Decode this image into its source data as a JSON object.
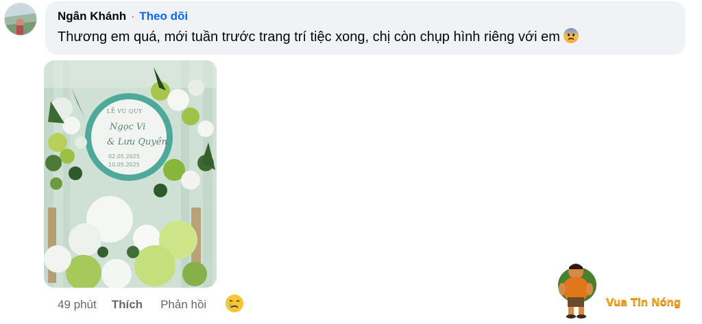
{
  "comment": {
    "author": "Ngân Khánh",
    "separator": "·",
    "follow_label": "Theo dõi",
    "text": "Thương em quá, mới tuần trước trang trí tiệc xong, chị còn chụp hình riêng với em",
    "text_emoji": "anxious-face-with-sweat-icon"
  },
  "photo": {
    "sign_title": "LỄ VU QUY",
    "name_line_1": "Ngọc Vi",
    "name_line_2": "& Lưu Quyền",
    "date_1": "02.05.2025",
    "date_2": "10.05.2025"
  },
  "actions": {
    "time": "49 phút",
    "like_label": "Thích",
    "reply_label": "Phản hồi",
    "reaction_icon": "crying-face-icon"
  },
  "watermark": {
    "brand": "Vua Tin Nóng"
  },
  "colors": {
    "bubble_bg": "#f0f2f5",
    "follow_blue": "#0866ff",
    "meta_gray": "#65676b",
    "watermark_orange": "#f6a51c"
  }
}
